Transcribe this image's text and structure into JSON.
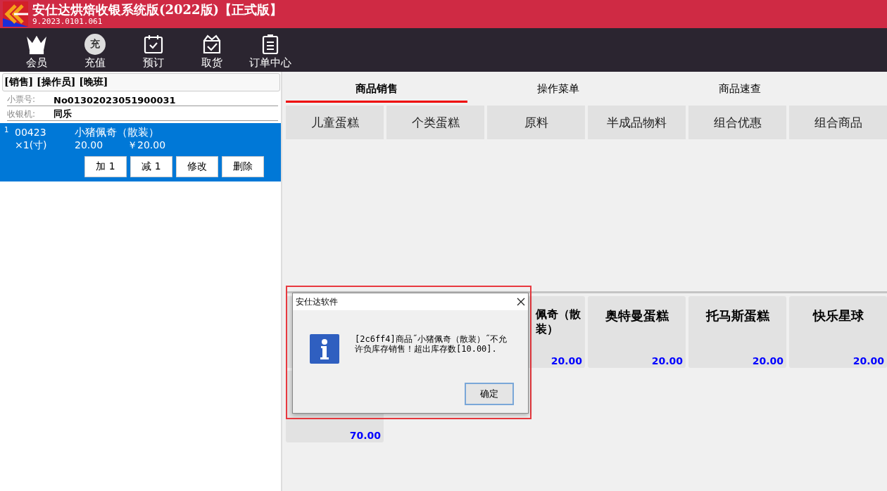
{
  "window": {
    "title": "安仕达烘焙收银系统版(2022版)【正式版】",
    "version": "9.2023.0101.061"
  },
  "toolbar": [
    {
      "label": "会员"
    },
    {
      "label": "充值",
      "badge": "充"
    },
    {
      "label": "预订"
    },
    {
      "label": "取货"
    },
    {
      "label": "订单中心"
    }
  ],
  "order": {
    "header": "[销售] [操作员] [晚班]",
    "fields": [
      {
        "label": "小票号:",
        "value": "No01302023051900031"
      },
      {
        "label": "收银机:",
        "value": "同乐"
      }
    ],
    "items": [
      {
        "index": "1",
        "code": "00423",
        "name": "小猪佩奇（散装）",
        "qty": "×1(寸)",
        "price": "20.00",
        "total": "￥20.00",
        "selected": true,
        "actions": [
          "加 1",
          "减 1",
          "修改",
          "删除"
        ]
      }
    ]
  },
  "tabs": [
    {
      "label": "商品销售",
      "selected": true
    },
    {
      "label": "操作菜单",
      "selected": false
    },
    {
      "label": "商品速查",
      "selected": false
    }
  ],
  "categories": [
    "儿童蛋糕",
    "个类蛋糕",
    "原料",
    "半成品物料",
    "组合优惠",
    "组合商品"
  ],
  "products": [
    {
      "kind": "card"
    },
    {
      "kind": "covered"
    },
    {
      "kind": "card",
      "name": "佩奇（散装）",
      "price": "20.00"
    },
    {
      "kind": "card",
      "name": "奥特曼蛋糕",
      "price": "20.00"
    },
    {
      "kind": "card",
      "name": "托马斯蛋糕",
      "price": "20.00"
    },
    {
      "kind": "card",
      "name": "快乐星球",
      "price": "20.00"
    },
    {
      "kind": "card",
      "price": "70.00"
    }
  ],
  "dialog": {
    "title": "安仕达软件",
    "message": "[2c6ff4]商品˝小猪佩奇（散装）˝不允许负库存销售！超出库存数[10.00].",
    "button": "确定"
  }
}
